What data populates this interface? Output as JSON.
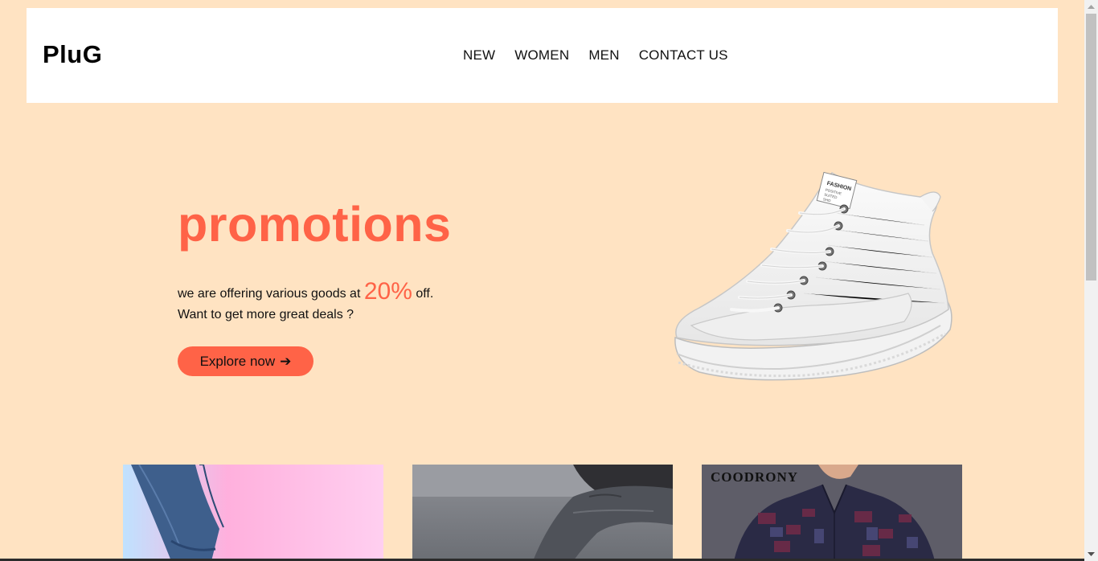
{
  "header": {
    "logo": "PluG",
    "nav": [
      "NEW",
      "WOMEN",
      "MEN",
      "CONTACT US"
    ]
  },
  "hero": {
    "title": "promotions",
    "line1_before": "we are offering various goods at ",
    "discount": "20%",
    "line1_after": " off.",
    "line2": "Want to get more great deals ?",
    "button_label": "Explore now",
    "button_arrow": "➔",
    "shoe_label_1": "FASHION",
    "shoe_label_2": "POSITIVE",
    "shoe_label_3": "SUITED",
    "shoe_label_4": "SHO"
  },
  "products": {
    "card3_brand": "COODRONY"
  },
  "colors": {
    "background": "#ffe3c2",
    "accent": "#ff6347",
    "header_bg": "#ffffff"
  },
  "icons": {
    "scroll_up": "triangle-up",
    "scroll_down": "triangle-down"
  }
}
